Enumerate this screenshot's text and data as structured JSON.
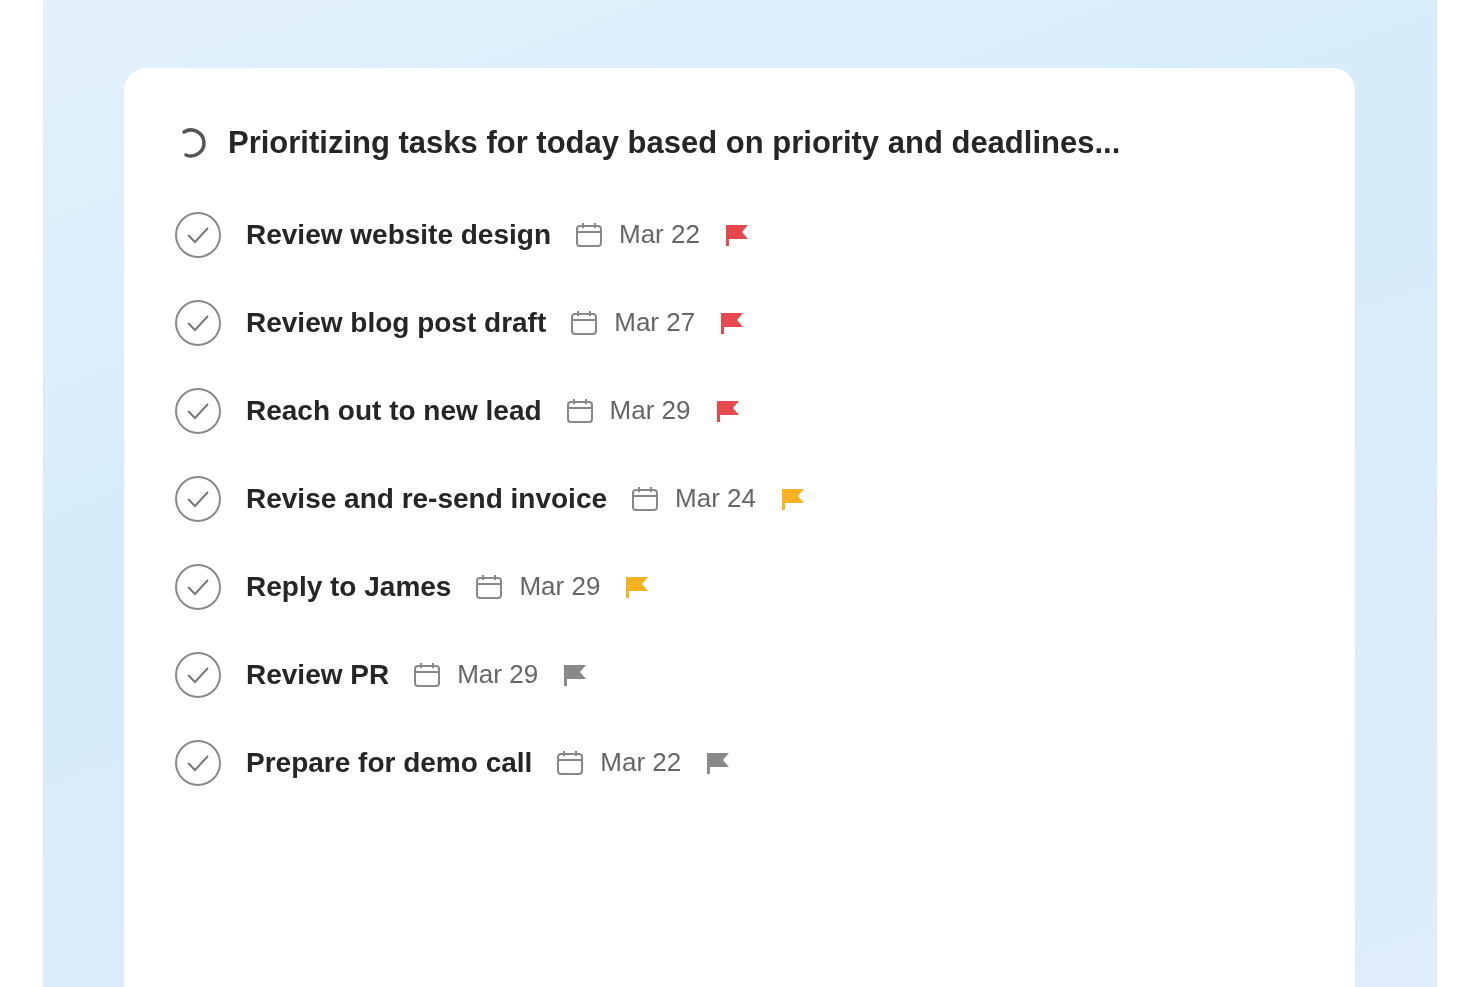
{
  "status": {
    "text": "Prioritizing tasks for today based on priority and deadlines..."
  },
  "tasks": [
    {
      "title": "Review website design",
      "date": "Mar 22",
      "color": "#e5484d"
    },
    {
      "title": "Review blog post draft",
      "date": "Mar 27",
      "color": "#e5484d"
    },
    {
      "title": "Reach out to new lead",
      "date": "Mar 29",
      "color": "#e5484d"
    },
    {
      "title": "Revise and re-send invoice",
      "date": "Mar 24",
      "color": "#f5b324"
    },
    {
      "title": "Reply to James",
      "date": "Mar 29",
      "color": "#f5b324"
    },
    {
      "title": "Review PR",
      "date": "Mar 29",
      "color": "#8a8a8a"
    },
    {
      "title": "Prepare for demo call",
      "date": "Mar 22",
      "color": "#8a8a8a"
    }
  ]
}
